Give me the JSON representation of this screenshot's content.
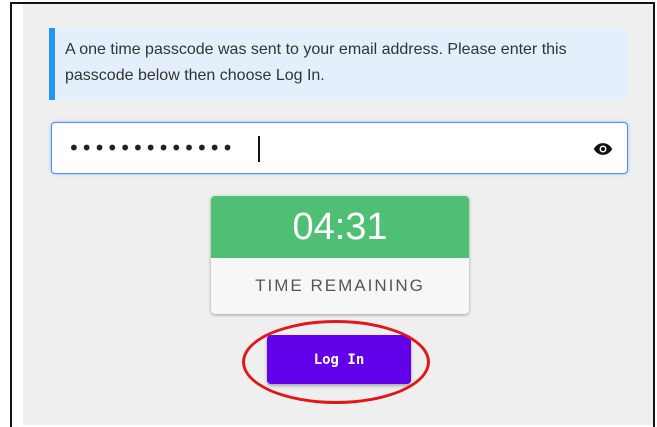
{
  "info": {
    "message": "A one time passcode was sent to your email address. Please enter this passcode below then choose Log In."
  },
  "passcode": {
    "masked_value": "•••••••••••••",
    "toggle_icon": "eye-icon"
  },
  "timer": {
    "value": "04:31",
    "label": "TIME REMAINING",
    "color": "#4fbf74"
  },
  "login": {
    "label": "Log In",
    "color": "#6200ea"
  },
  "annotation": {
    "color": "#e01818"
  }
}
